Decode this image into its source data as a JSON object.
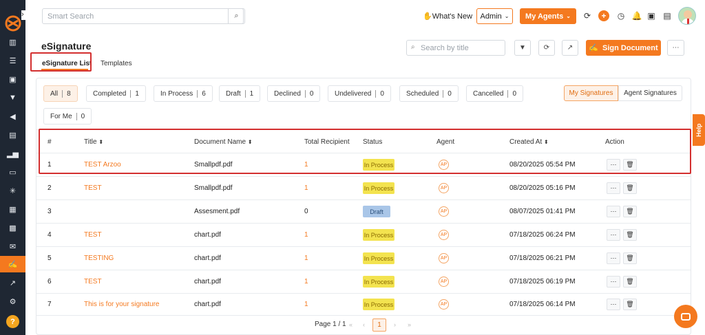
{
  "header": {
    "search_placeholder": "Smart Search",
    "whats_new": "What's New",
    "admin": "Admin",
    "my_agents": "My Agents"
  },
  "page": {
    "title": "eSignature",
    "tabs": [
      "eSignature List",
      "Templates"
    ],
    "title_search_placeholder": "Search by title",
    "sign_document": "Sign Document"
  },
  "filters": [
    {
      "label": "All",
      "count": "8"
    },
    {
      "label": "Completed",
      "count": "1"
    },
    {
      "label": "In Process",
      "count": "6"
    },
    {
      "label": "Draft",
      "count": "1"
    },
    {
      "label": "Declined",
      "count": "0"
    },
    {
      "label": "Undelivered",
      "count": "0"
    },
    {
      "label": "Scheduled",
      "count": "0"
    },
    {
      "label": "Cancelled",
      "count": "0"
    },
    {
      "label": "For Me",
      "count": "0"
    }
  ],
  "toggle": {
    "my": "My Signatures",
    "agent": "Agent Signatures"
  },
  "table": {
    "headers": [
      "#",
      "Title",
      "Document Name",
      "Total Recipient",
      "Status",
      "Agent",
      "Created At",
      "Action"
    ],
    "rows": [
      {
        "n": "1",
        "title": "TEST Arzoo",
        "doc": "Smallpdf.pdf",
        "recip": "1",
        "status": "In Process",
        "agent": "AP",
        "created": "08/20/2025 05:54 PM"
      },
      {
        "n": "2",
        "title": "TEST",
        "doc": "Smallpdf.pdf",
        "recip": "1",
        "status": "In Process",
        "agent": "AP",
        "created": "08/20/2025 05:16 PM"
      },
      {
        "n": "3",
        "title": "",
        "doc": "Assesment.pdf",
        "recip": "0",
        "status": "Draft",
        "agent": "AP",
        "created": "08/07/2025 01:41 PM"
      },
      {
        "n": "4",
        "title": "TEST",
        "doc": "chart.pdf",
        "recip": "1",
        "status": "In Process",
        "agent": "AP",
        "created": "07/18/2025 06:24 PM"
      },
      {
        "n": "5",
        "title": "TESTING",
        "doc": "chart.pdf",
        "recip": "1",
        "status": "In Process",
        "agent": "AP",
        "created": "07/18/2025 06:21 PM"
      },
      {
        "n": "6",
        "title": "TEST",
        "doc": "chart.pdf",
        "recip": "1",
        "status": "In Process",
        "agent": "AP",
        "created": "07/18/2025 06:19 PM"
      },
      {
        "n": "7",
        "title": "This is for your signature",
        "doc": "chart.pdf",
        "recip": "1",
        "status": "In Process",
        "agent": "AP",
        "created": "07/18/2025 06:14 PM"
      }
    ]
  },
  "pagination": {
    "label": "Page 1 / 1",
    "current": "1"
  },
  "help_tab": "Help",
  "icons": [
    "search-icon",
    "filter-icon",
    "refresh-icon",
    "chart-icon",
    "more-icon",
    "signature-icon",
    "bell-icon",
    "clock-icon",
    "plus-icon",
    "trash-icon"
  ],
  "colors": {
    "accent": "#f4791f",
    "rail": "#1f2733",
    "highlight": "#d32f2f",
    "in_process": "#f3e34f",
    "draft": "#a9c6e8"
  }
}
